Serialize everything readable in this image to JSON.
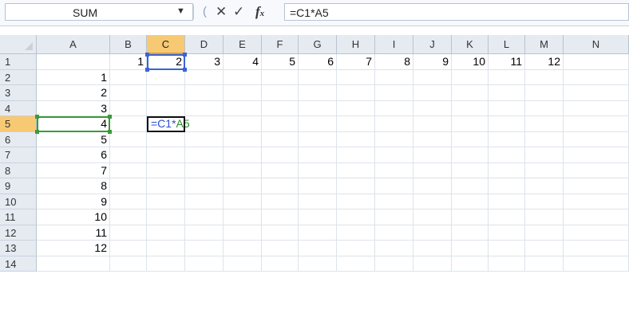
{
  "formula_bar": {
    "name_box": "SUM",
    "formula": "=C1*A5"
  },
  "grid": {
    "columns": [
      "A",
      "B",
      "C",
      "D",
      "E",
      "F",
      "G",
      "H",
      "I",
      "J",
      "K",
      "L",
      "M",
      "N"
    ],
    "rows": [
      "1",
      "2",
      "3",
      "4",
      "5",
      "6",
      "7",
      "8",
      "9",
      "10",
      "11",
      "12",
      "13",
      "14"
    ],
    "row1_values": [
      "1",
      "2",
      "3",
      "4",
      "5",
      "6",
      "7",
      "8",
      "9",
      "10",
      "11",
      "12"
    ],
    "colA_values": [
      "1",
      "2",
      "3",
      "4",
      "5",
      "6",
      "7",
      "8",
      "9",
      "10",
      "11",
      "12"
    ],
    "edit_cell": {
      "part1": "=C1",
      "part2": "*",
      "part3": "A5"
    }
  },
  "colors": {
    "ref_c1": "#2c4fd6",
    "ref_a5": "#2d8a2d",
    "header_active": "#f7c972"
  }
}
